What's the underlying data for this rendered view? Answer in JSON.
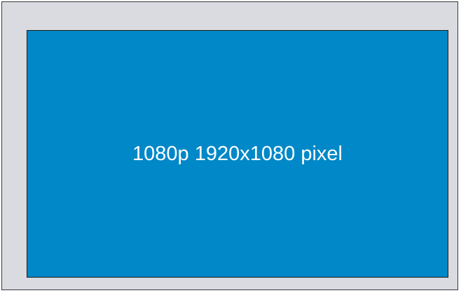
{
  "display": {
    "label": "1080p 1920x1080 pixel"
  },
  "colors": {
    "bezel": "#d9dbe1",
    "screen": "#0088c8",
    "label_text": "#ffffff",
    "outline": "#1b1b1b"
  }
}
